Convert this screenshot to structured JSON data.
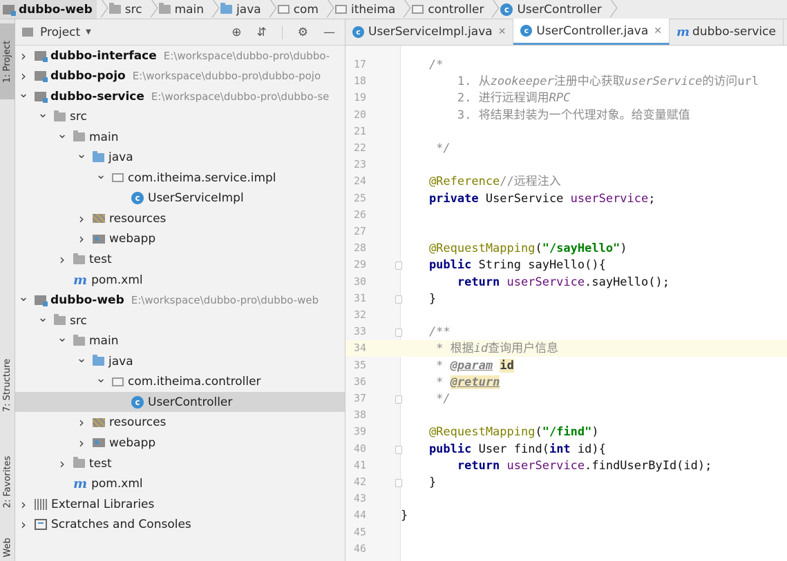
{
  "breadcrumb": [
    {
      "label": "dubbo-web",
      "icon": "module-icon"
    },
    {
      "label": "src",
      "icon": "folder-icon"
    },
    {
      "label": "main",
      "icon": "folder-icon"
    },
    {
      "label": "java",
      "icon": "source-folder-icon"
    },
    {
      "label": "com",
      "icon": "package-icon"
    },
    {
      "label": "itheima",
      "icon": "package-icon"
    },
    {
      "label": "controller",
      "icon": "package-icon"
    },
    {
      "label": "UserController",
      "icon": "class-icon"
    }
  ],
  "tool_strip": {
    "project_tab": "1: Project",
    "structure_tab": "7: Structure",
    "favorites_tab": "2: Favorites",
    "web_tab": "Web"
  },
  "project_panel": {
    "title": "Project",
    "tree": [
      {
        "label": "dubbo-interface",
        "path": "E:\\workspace\\dubbo-pro\\dubbo-",
        "depth": 0,
        "arrow": "right",
        "icon": "module",
        "bold": true
      },
      {
        "label": "dubbo-pojo",
        "path": "E:\\workspace\\dubbo-pro\\dubbo-pojo",
        "depth": 0,
        "arrow": "right",
        "icon": "module",
        "bold": true
      },
      {
        "label": "dubbo-service",
        "path": "E:\\workspace\\dubbo-pro\\dubbo-se",
        "depth": 0,
        "arrow": "down",
        "icon": "module",
        "bold": true
      },
      {
        "label": "src",
        "path": "",
        "depth": 1,
        "arrow": "down",
        "icon": "folder",
        "bold": false
      },
      {
        "label": "main",
        "path": "",
        "depth": 2,
        "arrow": "down",
        "icon": "folder",
        "bold": false
      },
      {
        "label": "java",
        "path": "",
        "depth": 3,
        "arrow": "down",
        "icon": "folder-blue",
        "bold": false
      },
      {
        "label": "com.itheima.service.impl",
        "path": "",
        "depth": 4,
        "arrow": "down",
        "icon": "package",
        "bold": false
      },
      {
        "label": "UserServiceImpl",
        "path": "",
        "depth": 5,
        "arrow": "none",
        "icon": "class",
        "bold": false
      },
      {
        "label": "resources",
        "path": "",
        "depth": 3,
        "arrow": "right",
        "icon": "resources",
        "bold": false
      },
      {
        "label": "webapp",
        "path": "",
        "depth": 3,
        "arrow": "right",
        "icon": "web",
        "bold": false
      },
      {
        "label": "test",
        "path": "",
        "depth": 2,
        "arrow": "right",
        "icon": "folder",
        "bold": false
      },
      {
        "label": "pom.xml",
        "path": "",
        "depth": 2,
        "arrow": "none",
        "icon": "maven",
        "bold": false
      },
      {
        "label": "dubbo-web",
        "path": "E:\\workspace\\dubbo-pro\\dubbo-web",
        "depth": 0,
        "arrow": "down",
        "icon": "module",
        "bold": true
      },
      {
        "label": "src",
        "path": "",
        "depth": 1,
        "arrow": "down",
        "icon": "folder",
        "bold": false
      },
      {
        "label": "main",
        "path": "",
        "depth": 2,
        "arrow": "down",
        "icon": "folder",
        "bold": false
      },
      {
        "label": "java",
        "path": "",
        "depth": 3,
        "arrow": "down",
        "icon": "folder-blue",
        "bold": false
      },
      {
        "label": "com.itheima.controller",
        "path": "",
        "depth": 4,
        "arrow": "down",
        "icon": "package",
        "bold": false
      },
      {
        "label": "UserController",
        "path": "",
        "depth": 5,
        "arrow": "none",
        "icon": "class",
        "bold": false,
        "selected": true
      },
      {
        "label": "resources",
        "path": "",
        "depth": 3,
        "arrow": "right",
        "icon": "resources",
        "bold": false
      },
      {
        "label": "webapp",
        "path": "",
        "depth": 3,
        "arrow": "right",
        "icon": "web",
        "bold": false
      },
      {
        "label": "test",
        "path": "",
        "depth": 2,
        "arrow": "right",
        "icon": "folder",
        "bold": false
      },
      {
        "label": "pom.xml",
        "path": "",
        "depth": 2,
        "arrow": "none",
        "icon": "maven",
        "bold": false
      },
      {
        "label": "External Libraries",
        "path": "",
        "depth": 0,
        "arrow": "right",
        "icon": "libraries",
        "bold": false
      },
      {
        "label": "Scratches and Consoles",
        "path": "",
        "depth": 0,
        "arrow": "right",
        "icon": "scratches",
        "bold": false
      }
    ]
  },
  "editor": {
    "tabs": [
      {
        "label": "UserServiceImpl.java",
        "icon": "class-icon",
        "active": false
      },
      {
        "label": "UserController.java",
        "icon": "class-icon",
        "active": true
      },
      {
        "label": "dubbo-service",
        "icon": "maven-icon",
        "active": false
      }
    ],
    "first_line_number": 17,
    "highlighted_line": 34,
    "fold_markers_at": [
      29,
      31,
      33,
      37,
      40,
      42
    ],
    "lines": [
      [
        {
          "t": "    /*",
          "c": "c-comment"
        }
      ],
      [
        {
          "t": "        1. 从",
          "c": "c-cmt-plain"
        },
        {
          "t": "zookeeper",
          "c": "c-comment"
        },
        {
          "t": "注册中心获取",
          "c": "c-cmt-plain"
        },
        {
          "t": "userService",
          "c": "c-comment"
        },
        {
          "t": "的访问url",
          "c": "c-cmt-plain"
        }
      ],
      [
        {
          "t": "        2. 进行远程调用",
          "c": "c-cmt-plain"
        },
        {
          "t": "RPC",
          "c": "c-comment"
        }
      ],
      [
        {
          "t": "        3. 将结果封装为一个代理对象。给变量赋值",
          "c": "c-cmt-plain"
        }
      ],
      [
        {
          "t": "",
          "c": "c-plain"
        }
      ],
      [
        {
          "t": "     */",
          "c": "c-comment"
        }
      ],
      [
        {
          "t": "",
          "c": "c-plain"
        }
      ],
      [
        {
          "t": "    @Reference",
          "c": "c-anno"
        },
        {
          "t": "//远程注入",
          "c": "c-cmt-plain"
        }
      ],
      [
        {
          "t": "    private ",
          "c": "c-kw"
        },
        {
          "t": "UserService ",
          "c": "c-plain"
        },
        {
          "t": "userService",
          "c": "c-field"
        },
        {
          "t": ";",
          "c": "c-plain"
        }
      ],
      [
        {
          "t": "",
          "c": "c-plain"
        }
      ],
      [
        {
          "t": "",
          "c": "c-plain"
        }
      ],
      [
        {
          "t": "    @RequestMapping",
          "c": "c-anno"
        },
        {
          "t": "(",
          "c": "c-plain"
        },
        {
          "t": "\"/sayHello\"",
          "c": "c-str"
        },
        {
          "t": ")",
          "c": "c-plain"
        }
      ],
      [
        {
          "t": "    public ",
          "c": "c-kw"
        },
        {
          "t": "String sayHello(){",
          "c": "c-plain"
        }
      ],
      [
        {
          "t": "        return ",
          "c": "c-kw"
        },
        {
          "t": "userService",
          "c": "c-field"
        },
        {
          "t": ".sayHello();",
          "c": "c-plain"
        }
      ],
      [
        {
          "t": "    }",
          "c": "c-plain"
        }
      ],
      [
        {
          "t": "",
          "c": "c-plain"
        }
      ],
      [
        {
          "t": "    /**",
          "c": "c-comment"
        }
      ],
      [
        {
          "t": "     * 根据",
          "c": "c-cmt-plain"
        },
        {
          "t": "id",
          "c": "c-comment"
        },
        {
          "t": "查询用户信息",
          "c": "c-cmt-plain"
        }
      ],
      [
        {
          "t": "     * ",
          "c": "c-cmt-plain"
        },
        {
          "t": "@param",
          "c": "c-doctag"
        },
        {
          "t": " ",
          "c": "c-plain"
        },
        {
          "t": "id",
          "c": "c-docparam"
        }
      ],
      [
        {
          "t": "     * ",
          "c": "c-cmt-plain"
        },
        {
          "t": "@return",
          "c": "c-doctag2"
        }
      ],
      [
        {
          "t": "     */",
          "c": "c-comment"
        }
      ],
      [
        {
          "t": "",
          "c": "c-plain"
        }
      ],
      [
        {
          "t": "    @RequestMapping",
          "c": "c-anno"
        },
        {
          "t": "(",
          "c": "c-plain"
        },
        {
          "t": "\"/find\"",
          "c": "c-str"
        },
        {
          "t": ")",
          "c": "c-plain"
        }
      ],
      [
        {
          "t": "    public ",
          "c": "c-kw"
        },
        {
          "t": "User find(",
          "c": "c-plain"
        },
        {
          "t": "int ",
          "c": "c-kw"
        },
        {
          "t": "id){",
          "c": "c-plain"
        }
      ],
      [
        {
          "t": "        return ",
          "c": "c-kw"
        },
        {
          "t": "userService",
          "c": "c-field"
        },
        {
          "t": ".findUserById(id);",
          "c": "c-plain"
        }
      ],
      [
        {
          "t": "    }",
          "c": "c-plain"
        }
      ],
      [
        {
          "t": "",
          "c": "c-plain"
        }
      ],
      [
        {
          "t": "}",
          "c": "c-plain"
        }
      ],
      [
        {
          "t": "",
          "c": "c-plain"
        }
      ],
      [
        {
          "t": "",
          "c": "c-plain"
        }
      ]
    ]
  }
}
